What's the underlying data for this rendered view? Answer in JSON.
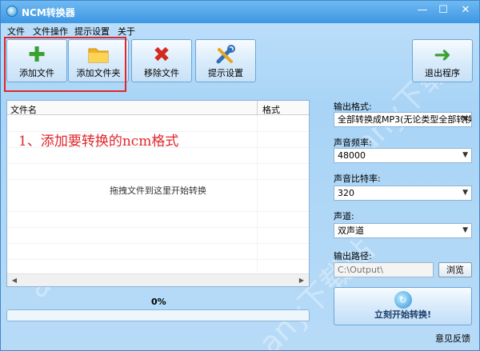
{
  "window": {
    "title": "NCM转换器"
  },
  "menu": [
    "文件",
    "文件操作",
    "提示设置",
    "关于"
  ],
  "toolbar": {
    "add_file": "添加文件",
    "add_folder": "添加文件夹",
    "remove_file": "移除文件",
    "hint_settings": "提示设置",
    "exit": "退出程序"
  },
  "file_list": {
    "columns": [
      "文件名",
      "格式"
    ],
    "drop_hint": "拖拽文件到这里开始转换",
    "annotation": "1、添加要转换的ncm格式"
  },
  "progress": {
    "label": "0%",
    "value": 0
  },
  "settings": {
    "output_format_label": "输出格式:",
    "output_format_value": "全部转换成MP3(无论类型全部转换",
    "sample_rate_label": "声音频率:",
    "sample_rate_value": "48000",
    "bitrate_label": "声音比特率:",
    "bitrate_value": "320",
    "channel_label": "声道:",
    "channel_value": "双声道",
    "output_path_label": "输出路径:",
    "output_path_value": "C:\\Output\\",
    "browse": "浏览",
    "start": "立刻开始转换!"
  },
  "feedback": "意见反馈",
  "watermark": "any下载站",
  "colors": {
    "annotation": "#e0262b",
    "accent": "#3d97e3"
  },
  "icons": {
    "add_file": "plus-icon",
    "add_folder": "folder-icon",
    "remove_file": "x-icon",
    "hint_settings": "tools-icon",
    "exit": "arrow-right-icon",
    "start": "refresh-icon"
  }
}
